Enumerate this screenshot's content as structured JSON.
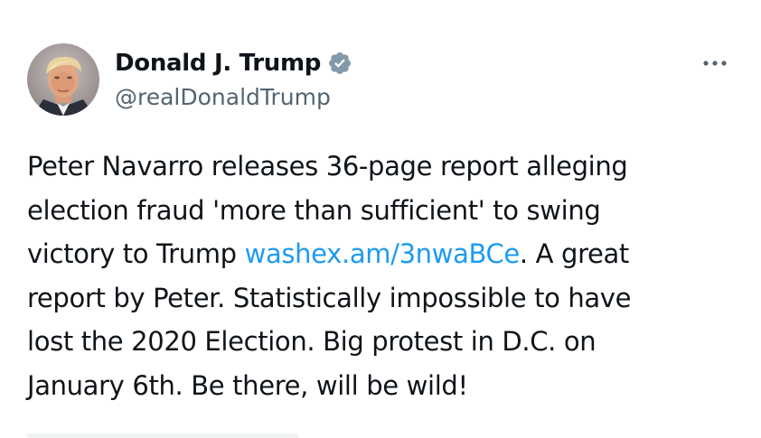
{
  "author": {
    "display_name": "Donald J. Trump",
    "handle": "@realDonaldTrump",
    "verified": true,
    "verified_badge_color": "#829aab"
  },
  "icons": {
    "avatar": "profile-photo",
    "verified": "verified-badge-icon",
    "more": "more-options-icon"
  },
  "tweet": {
    "line1": "Peter Navarro releases 36-page report alleging",
    "line2": "election fraud 'more than sufficient' to swing",
    "line3_before_link": "victory to Trump ",
    "link_text": "washex.am/3nwaBCe",
    "line3_after_link": ". A great",
    "line4": "report by Peter. Statistically impossible to have",
    "line5": "lost the 2020 Election. Big protest in D.C. on",
    "line6": "January 6th. Be there, will be wild!"
  },
  "colors": {
    "text": "#0f1419",
    "secondary_text": "#536471",
    "link": "#1d9bf0",
    "background": "#ffffff"
  }
}
